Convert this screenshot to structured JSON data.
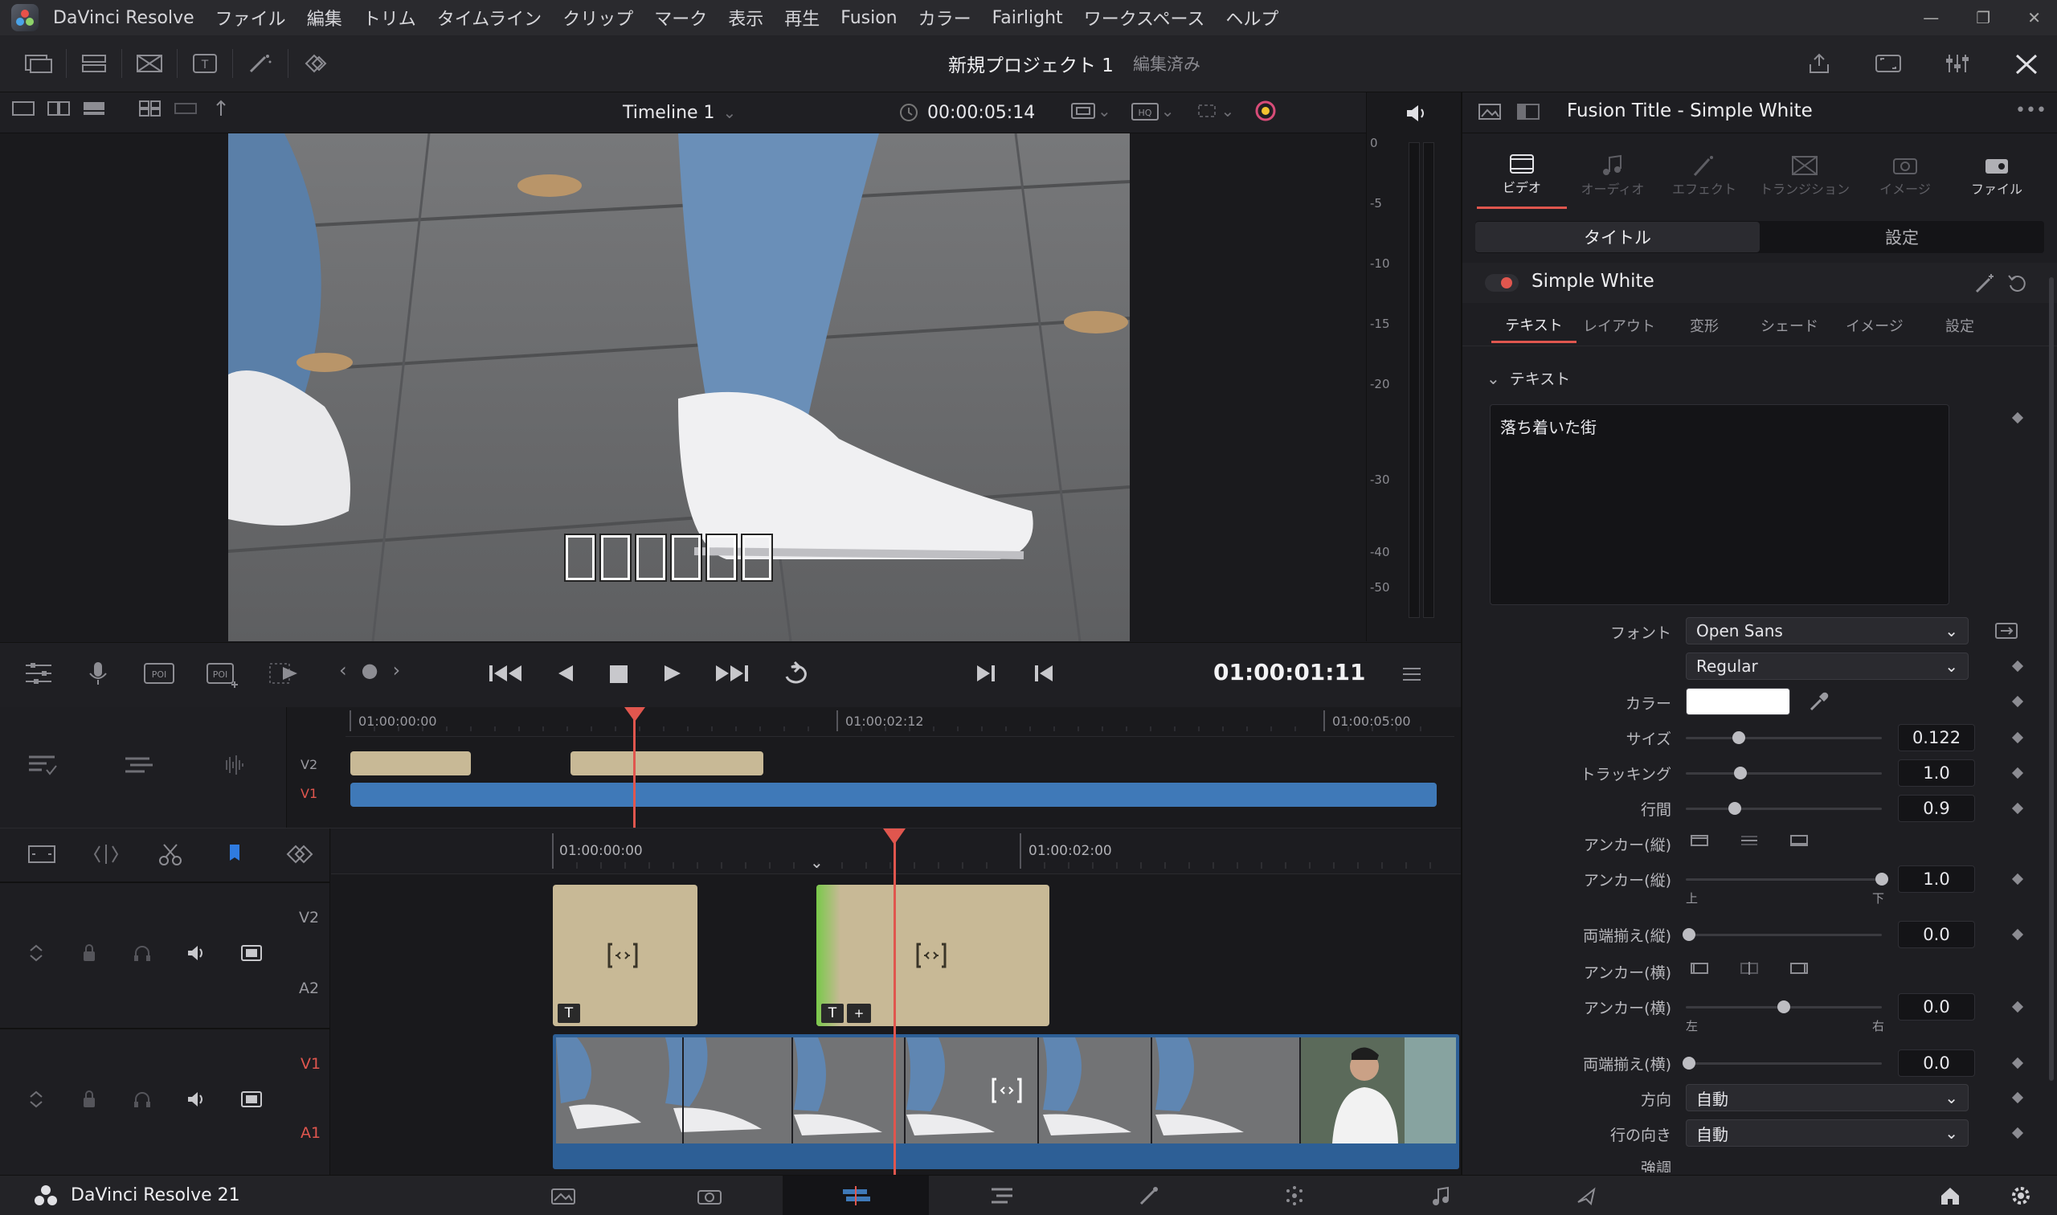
{
  "app": {
    "name": "DaVinci Resolve",
    "version_label": "DaVinci Resolve 21"
  },
  "menu": [
    "ファイル",
    "編集",
    "トリム",
    "タイムライン",
    "クリップ",
    "マーク",
    "表示",
    "再生",
    "Fusion",
    "カラー",
    "Fairlight",
    "ワークスペース",
    "ヘルプ"
  ],
  "project": {
    "title": "新規プロジェクト 1",
    "status": "編集済み"
  },
  "viewer": {
    "timeline_name": "Timeline 1",
    "duration_tc": "00:00:05:14",
    "current_tc": "01:00:01:11",
    "overlay_boxes": 6
  },
  "meter": {
    "ticks": [
      "0",
      "-5",
      "-10",
      "-15",
      "-20",
      "-30",
      "-40",
      "-50"
    ]
  },
  "mini_timeline": {
    "ruler": [
      "01:00:00:00",
      "01:00:02:12",
      "01:00:05:00"
    ],
    "tracks": [
      "V2",
      "V1"
    ]
  },
  "main_timeline": {
    "ruler": [
      "01:00:00:00",
      "01:00:02:00"
    ],
    "tracks": [
      {
        "video": "V2",
        "audio": "A2"
      },
      {
        "video": "V1",
        "audio": "A1"
      }
    ]
  },
  "inspector": {
    "title": "Fusion Title - Simple White",
    "tabs": [
      "ビデオ",
      "オーディオ",
      "エフェクト",
      "トランジション",
      "イメージ",
      "ファイル"
    ],
    "subtabs": [
      "タイトル",
      "設定"
    ],
    "effect_name": "Simple White",
    "section_tabs": [
      "テキスト",
      "レイアウト",
      "変形",
      "シェード",
      "イメージ",
      "設定"
    ],
    "section_header": "テキスト",
    "text_value": "落ち着いた街",
    "font_label": "フォント",
    "font": "Open Sans",
    "style": "Regular",
    "color_label": "カラー",
    "color_value": "#ffffff",
    "size_label": "サイズ",
    "size": "0.122",
    "size_level": 0.27,
    "tracking_label": "トラッキング",
    "tracking": "1.0",
    "tracking_level": 0.28,
    "line_label": "行間",
    "line": "0.9",
    "line_level": 0.25,
    "anchor_v_label": "アンカー(縦)",
    "anchor_v2_label": "アンカー(縦)",
    "anchor_v2": "1.0",
    "anchor_v2_level": 1.0,
    "anchor_v2_top": "上",
    "anchor_v2_bottom": "下",
    "justify_v_label": "両端揃え(縦)",
    "justify_v": "0.0",
    "anchor_h_label": "アンカー(横)",
    "anchor_h2_label": "アンカー(横)",
    "anchor_h2": "0.0",
    "anchor_h2_level": 0.5,
    "anchor_h2_left": "左",
    "anchor_h2_right": "右",
    "justify_h_label": "両端揃え(横)",
    "justify_h": "0.0",
    "direction_label": "方向",
    "direction": "自動",
    "line_direction_label": "行の向き",
    "line_direction": "自動",
    "emphasis_label": "強調"
  }
}
